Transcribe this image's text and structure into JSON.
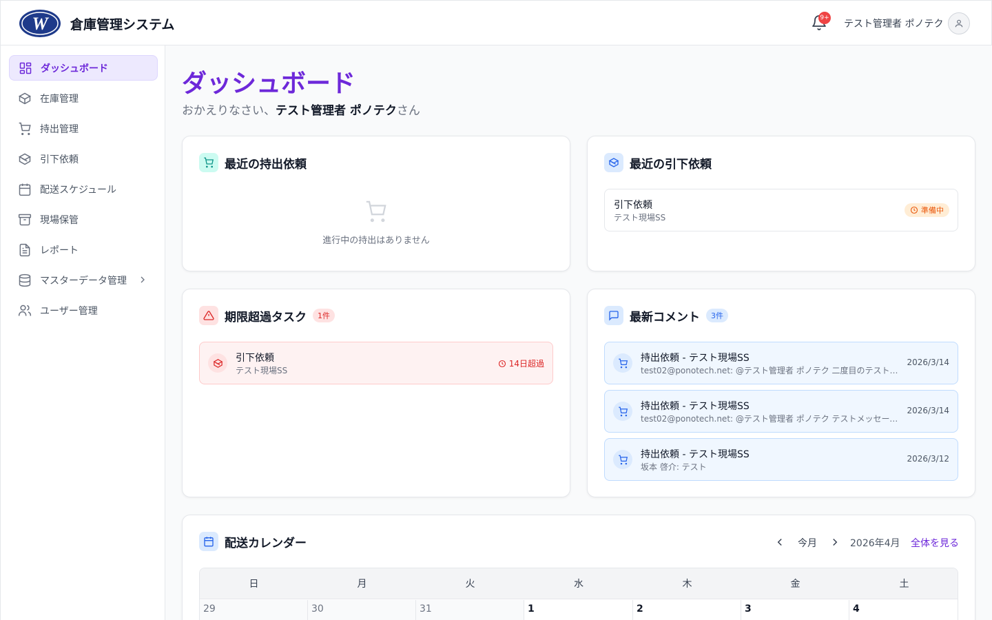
{
  "header": {
    "app_title": "倉庫管理システム",
    "notification_badge": "9+",
    "user_name": "テスト管理者 ポノテク"
  },
  "sidebar": {
    "items": [
      {
        "label": "ダッシュボード",
        "icon": "dashboard-icon",
        "active": true
      },
      {
        "label": "在庫管理",
        "icon": "box-icon"
      },
      {
        "label": "持出管理",
        "icon": "cart-icon"
      },
      {
        "label": "引下依頼",
        "icon": "box-return-icon"
      },
      {
        "label": "配送スケジュール",
        "icon": "calendar-icon"
      },
      {
        "label": "現場保管",
        "icon": "archive-icon"
      },
      {
        "label": "レポート",
        "icon": "report-icon"
      },
      {
        "label": "マスターデータ管理",
        "icon": "database-icon"
      },
      {
        "label": "ユーザー管理",
        "icon": "users-icon"
      }
    ]
  },
  "main": {
    "title": "ダッシュボード",
    "welcome_prefix": "おかえりなさい、",
    "welcome_name": "テスト管理者 ポノテク",
    "welcome_suffix": "さん"
  },
  "recent_checkout": {
    "title": "最近の持出依頼",
    "empty_text": "進行中の持出はありません"
  },
  "recent_return": {
    "title": "最近の引下依頼",
    "items": [
      {
        "title": "引下依頼",
        "sub": "テスト現場SS",
        "status": "準備中"
      }
    ]
  },
  "overdue": {
    "title": "期限超過タスク",
    "count": "1件",
    "items": [
      {
        "title": "引下依頼",
        "sub": "テスト現場SS",
        "overdue": "14日超過"
      }
    ]
  },
  "comments": {
    "title": "最新コメント",
    "count": "3件",
    "items": [
      {
        "title": "持出依頼 - テスト現場SS",
        "sub": "test02@ponotech.net: @テスト管理者 ポノテク 二度目のテストメ...",
        "date": "2026/3/14"
      },
      {
        "title": "持出依頼 - テスト現場SS",
        "sub": "test02@ponotech.net: @テスト管理者 ポノテク テストメッセージ...",
        "date": "2026/3/14"
      },
      {
        "title": "持出依頼 - テスト現場SS",
        "sub": "坂本 啓介: テスト",
        "date": "2026/3/12"
      }
    ]
  },
  "calendar": {
    "title": "配送カレンダー",
    "today_label": "今月",
    "month_label": "2026年4月",
    "view_all": "全体を見る",
    "weekdays": [
      "日",
      "月",
      "火",
      "水",
      "木",
      "金",
      "土"
    ],
    "days": [
      "29",
      "30",
      "31",
      "1",
      "2",
      "3",
      "4"
    ]
  }
}
